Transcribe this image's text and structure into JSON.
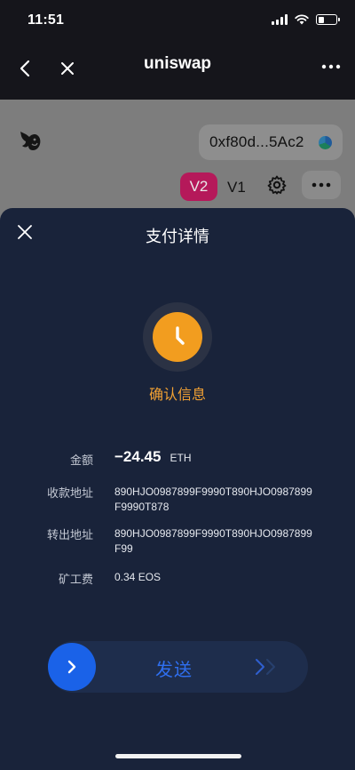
{
  "status_bar": {
    "time": "11:51"
  },
  "nav": {
    "title": "uniswap"
  },
  "app": {
    "address": "0xf80d...5Ac2",
    "version_active": "V2",
    "version_other": "V1"
  },
  "sheet": {
    "title": "支付详情",
    "status_text": "确认信息",
    "rows": [
      {
        "label": "金额",
        "value": "−24.45",
        "unit": "ETH"
      },
      {
        "label": "收款地址",
        "value": "890HJO0987899F9990T890HJO0987899F9990T878"
      },
      {
        "label": "转出地址",
        "value": "890HJO0987899F9990T890HJO0987899F99"
      },
      {
        "label": "矿工费",
        "value": "0.34 EOS"
      }
    ],
    "send_label": "发送"
  },
  "colors": {
    "sheet_bg": "#19233a",
    "accent_orange": "#f29d1f",
    "accent_blue": "#1a62e8",
    "version_pink": "#b5195a"
  },
  "icons": [
    "back-icon",
    "close-icon",
    "more-icon",
    "unicorn-logo-icon",
    "gear-icon",
    "clock-icon",
    "chevron-right-icon",
    "double-chevron-icon"
  ]
}
